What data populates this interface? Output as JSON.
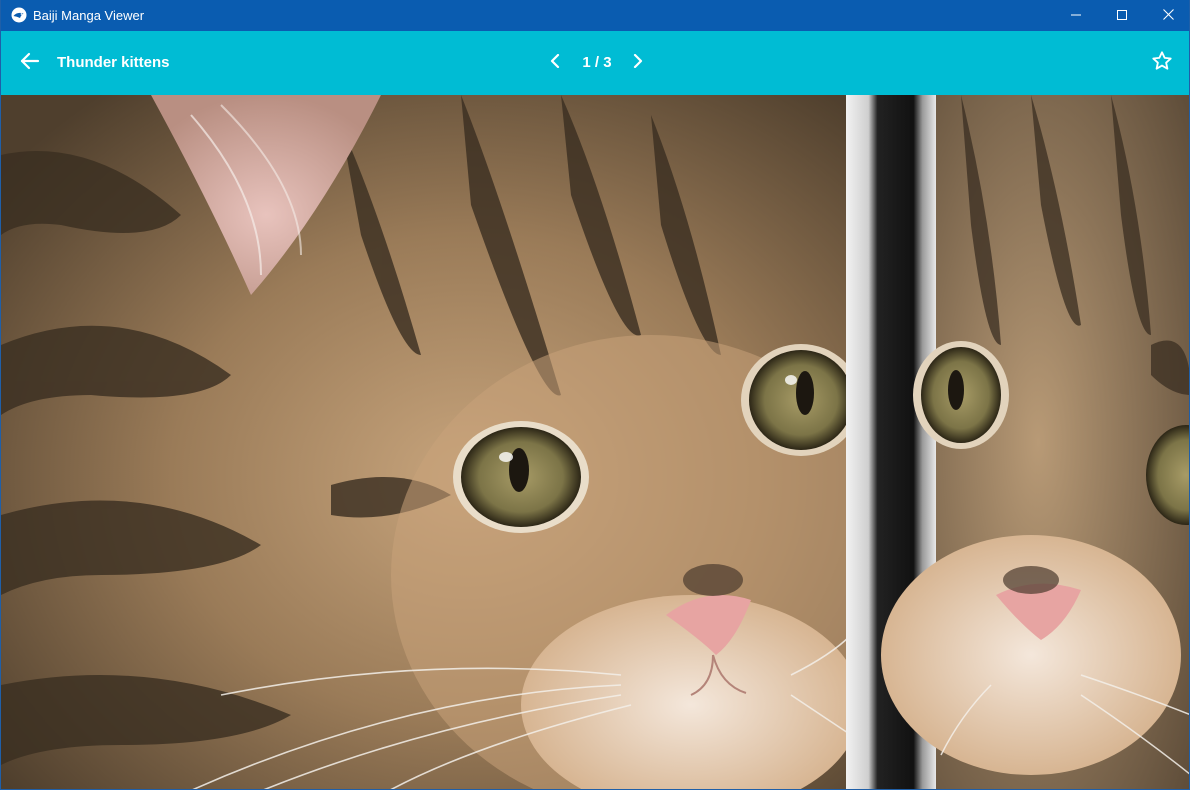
{
  "window": {
    "title": "Baiji Manga Viewer",
    "icon": "baiji-app-icon",
    "controls": [
      "minimize-icon",
      "maximize-icon",
      "close-icon"
    ]
  },
  "appbar": {
    "back_icon": "arrow-left-icon",
    "album_title": "Thunder kittens",
    "prev_icon": "chevron-left-icon",
    "page_counter": "1 / 3",
    "next_icon": "chevron-right-icon",
    "favorite_icon": "star-outline-icon",
    "background": "#00bcd4"
  },
  "viewer": {
    "image_subject": "tabby kitten next to a mirror"
  },
  "colors": {
    "titlebar": "#0a5cb0",
    "accent": "#00bcd4"
  }
}
